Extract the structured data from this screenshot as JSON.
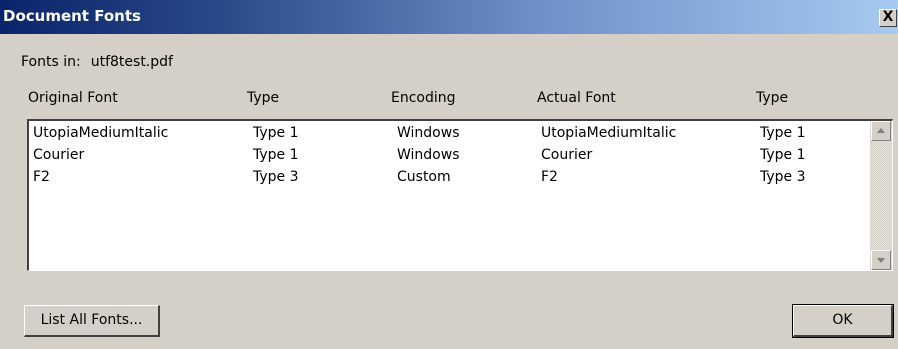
{
  "window": {
    "title": "Document Fonts",
    "close_label": "X"
  },
  "fonts_in": {
    "label": "Fonts in:",
    "filename": "utf8test.pdf"
  },
  "columns": {
    "original_font": "Original Font",
    "type": "Type",
    "encoding": "Encoding",
    "actual_font": "Actual Font",
    "actual_type": "Type"
  },
  "rows": [
    {
      "original_font": "UtopiaMediumItalic",
      "type": "Type 1",
      "encoding": "Windows",
      "actual_font": "UtopiaMediumItalic",
      "actual_type": "Type 1"
    },
    {
      "original_font": "Courier",
      "type": "Type 1",
      "encoding": "Windows",
      "actual_font": "Courier",
      "actual_type": "Type 1"
    },
    {
      "original_font": "F2",
      "type": "Type 3",
      "encoding": "Custom",
      "actual_font": "F2",
      "actual_type": "Type 3"
    }
  ],
  "buttons": {
    "list_all_fonts": "List All Fonts...",
    "ok": "OK"
  },
  "icons": {
    "close": "close-icon",
    "scroll_up": "scroll-up-arrow-icon",
    "scroll_down": "scroll-down-arrow-icon"
  }
}
